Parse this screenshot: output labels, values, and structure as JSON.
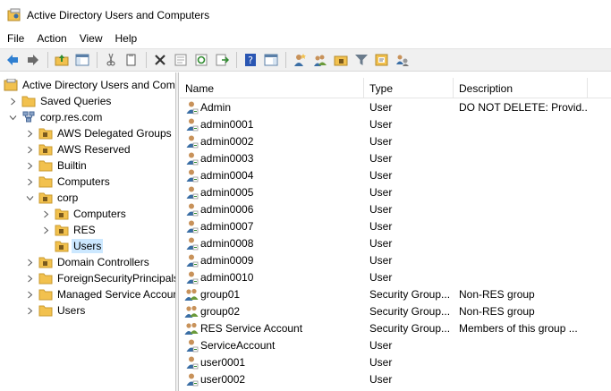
{
  "window": {
    "title": "Active Directory Users and Computers"
  },
  "menu": [
    "File",
    "Action",
    "View",
    "Help"
  ],
  "toolbar": {
    "buttons": [
      "back-icon",
      "forward-icon",
      "up-folder-icon",
      "show-console-tree-icon",
      "cut-icon",
      "copy-icon",
      "delete-icon",
      "properties-icon",
      "refresh-icon",
      "export-list-icon",
      "help-icon",
      "action-pane-icon",
      "new-user-icon",
      "new-group-icon",
      "new-ou-icon",
      "filter-icon",
      "find-icon",
      "delegate-icon"
    ]
  },
  "tree": {
    "items": [
      {
        "label": "Active Directory Users and Com",
        "level": 0,
        "expander": "none",
        "icon": "console-root"
      },
      {
        "label": "Saved Queries",
        "level": 1,
        "expander": "collapsed",
        "icon": "folder"
      },
      {
        "label": "corp.res.com",
        "level": 1,
        "expander": "expanded",
        "icon": "domain"
      },
      {
        "label": "AWS Delegated Groups",
        "level": 2,
        "expander": "collapsed",
        "icon": "ou"
      },
      {
        "label": "AWS Reserved",
        "level": 2,
        "expander": "collapsed",
        "icon": "ou"
      },
      {
        "label": "Builtin",
        "level": 2,
        "expander": "collapsed",
        "icon": "folder"
      },
      {
        "label": "Computers",
        "level": 2,
        "expander": "collapsed",
        "icon": "folder"
      },
      {
        "label": "corp",
        "level": 2,
        "expander": "expanded",
        "icon": "ou"
      },
      {
        "label": "Computers",
        "level": 3,
        "expander": "collapsed",
        "icon": "ou"
      },
      {
        "label": "RES",
        "level": 3,
        "expander": "collapsed",
        "icon": "ou"
      },
      {
        "label": "Users",
        "level": 3,
        "expander": "none",
        "icon": "ou",
        "selected": true
      },
      {
        "label": "Domain Controllers",
        "level": 2,
        "expander": "collapsed",
        "icon": "ou"
      },
      {
        "label": "ForeignSecurityPrincipals",
        "level": 2,
        "expander": "collapsed",
        "icon": "folder"
      },
      {
        "label": "Managed Service Accour",
        "level": 2,
        "expander": "collapsed",
        "icon": "folder"
      },
      {
        "label": "Users",
        "level": 2,
        "expander": "collapsed",
        "icon": "folder"
      }
    ]
  },
  "list": {
    "columns": [
      "Name",
      "Type",
      "Description"
    ],
    "rows": [
      {
        "name": "Admin",
        "type": "User",
        "description": "DO NOT DELETE:  Provid...",
        "icon": "user"
      },
      {
        "name": "admin0001",
        "type": "User",
        "description": "",
        "icon": "user"
      },
      {
        "name": "admin0002",
        "type": "User",
        "description": "",
        "icon": "user"
      },
      {
        "name": "admin0003",
        "type": "User",
        "description": "",
        "icon": "user"
      },
      {
        "name": "admin0004",
        "type": "User",
        "description": "",
        "icon": "user"
      },
      {
        "name": "admin0005",
        "type": "User",
        "description": "",
        "icon": "user"
      },
      {
        "name": "admin0006",
        "type": "User",
        "description": "",
        "icon": "user"
      },
      {
        "name": "admin0007",
        "type": "User",
        "description": "",
        "icon": "user"
      },
      {
        "name": "admin0008",
        "type": "User",
        "description": "",
        "icon": "user"
      },
      {
        "name": "admin0009",
        "type": "User",
        "description": "",
        "icon": "user"
      },
      {
        "name": "admin0010",
        "type": "User",
        "description": "",
        "icon": "user"
      },
      {
        "name": "group01",
        "type": "Security Group...",
        "description": "Non-RES group",
        "icon": "group"
      },
      {
        "name": "group02",
        "type": "Security Group...",
        "description": "Non-RES group",
        "icon": "group"
      },
      {
        "name": "RES Service Account",
        "type": "Security Group...",
        "description": "Members of this group ...",
        "icon": "group"
      },
      {
        "name": "ServiceAccount",
        "type": "User",
        "description": "",
        "icon": "user"
      },
      {
        "name": "user0001",
        "type": "User",
        "description": "",
        "icon": "user"
      },
      {
        "name": "user0002",
        "type": "User",
        "description": "",
        "icon": "user"
      }
    ]
  },
  "colors": {
    "selection": "#cce8ff",
    "folder": "#f2c14e",
    "ou_badge": "#7a5a1e",
    "user_head": "#3a6ea5"
  }
}
